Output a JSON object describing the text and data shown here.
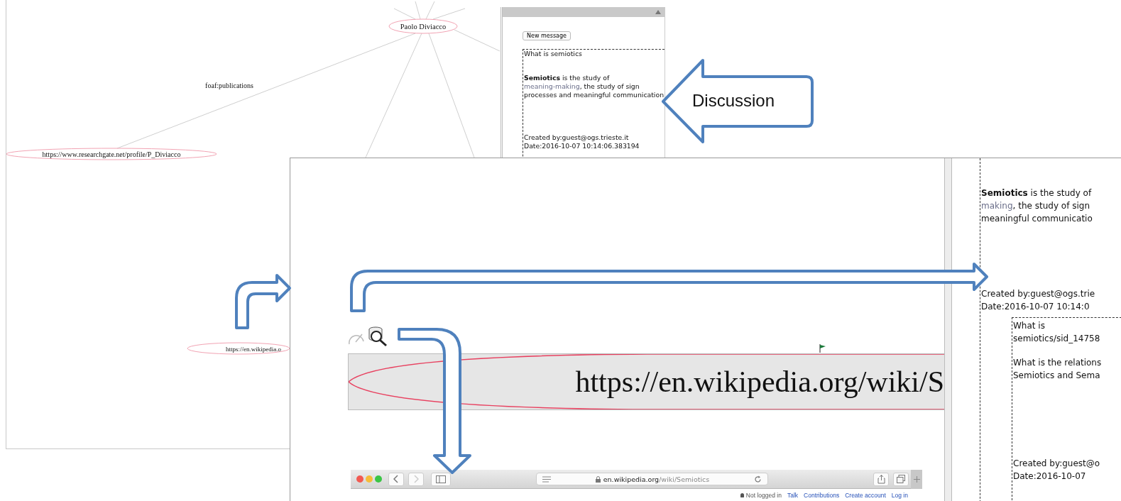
{
  "graph": {
    "nodes": [
      {
        "label": "Paolo Diviacco"
      },
      {
        "label": "https://www.researchgate.net/profile/P_Diviacco"
      },
      {
        "label": "https://en.wikipedia.o"
      }
    ],
    "edge_labels": [
      "foaf:publications"
    ]
  },
  "discussion": {
    "button": "New message",
    "message": {
      "title": "What is semiotics",
      "body": [
        {
          "text": "Semiotics",
          "kind": "bold"
        },
        {
          "text": " is the study of ",
          "kind": "plain"
        },
        {
          "text": "meaning-making",
          "kind": "link"
        },
        {
          "text": ", the study of sign processes and meaningful communication",
          "kind": "plain"
        }
      ],
      "created_by": "Created by:guest@ogs.trieste.it",
      "date": "Date:2016-10-07 10:14:06.383194"
    }
  },
  "callout": {
    "label": "Discussion"
  },
  "zoom_view": {
    "node_label": "https://en.wikipedia.org/wiki/S",
    "browser": {
      "url_host": "en.wikipedia.org",
      "url_path": "/wiki/Semiotics",
      "user_links": [
        {
          "text": "Not logged in",
          "kind": "status"
        },
        {
          "text": "Talk",
          "kind": "link"
        },
        {
          "text": "Contributions",
          "kind": "link"
        },
        {
          "text": "Create account",
          "kind": "link"
        },
        {
          "text": "Log in",
          "kind": "link"
        }
      ]
    },
    "discussion": {
      "message": {
        "body_lines": [
          [
            {
              "text": "Semiotics",
              "kind": "bold"
            },
            {
              "text": " is the study of",
              "kind": "plain"
            }
          ],
          [
            {
              "text": "making",
              "kind": "link"
            },
            {
              "text": ", the study of sign",
              "kind": "plain"
            }
          ],
          [
            {
              "text": "meaningful communicatio",
              "kind": "plain"
            }
          ]
        ],
        "created_by": "Created by:guest@ogs.trie",
        "date": "Date:2016-10-07 10:14:0"
      },
      "reply": {
        "title_lines": [
          "What is",
          "semiotics/sid_14758"
        ],
        "body_lines": [
          "What is the relations",
          "Semiotics and Sema"
        ],
        "created_by": "Created by:guest@o",
        "date": "Date:2016-10-07"
      }
    }
  }
}
